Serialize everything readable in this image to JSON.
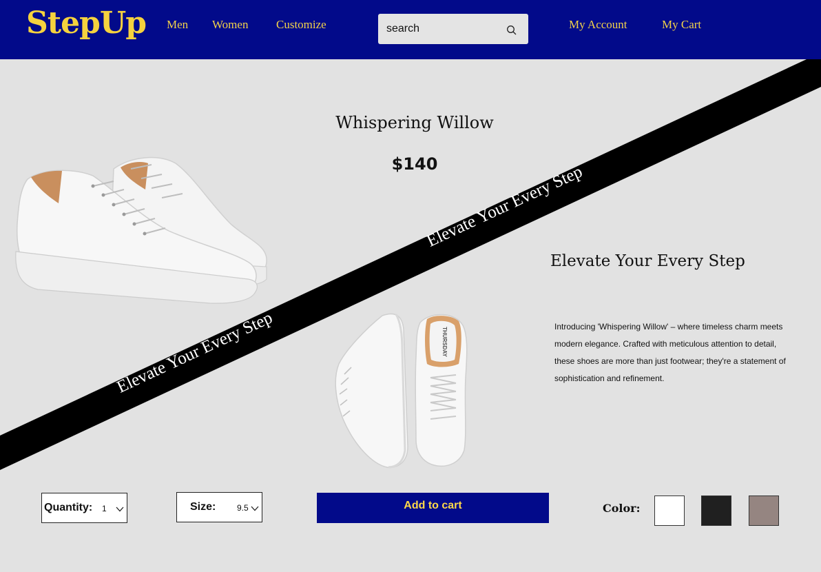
{
  "header": {
    "logo": "StepUp",
    "nav": [
      "Men",
      "Women",
      "Customize"
    ],
    "search": {
      "placeholder": "search"
    },
    "account": "My Account",
    "cart": "My Cart"
  },
  "banner": {
    "text_upper": "Elevate Your Every Step",
    "text_lower": "Elevate Your Every Step"
  },
  "product": {
    "name": "Whispering Willow",
    "price": "$140",
    "tagline": "Elevate Your Every Step",
    "description": "Introducing 'Whispering Willow' – where timeless charm meets modern elegance. Crafted with meticulous attention to detail, these shoes are more than just footwear; they're a statement of sophistication and refinement.",
    "brand_on_insole": "THURSDAY"
  },
  "controls": {
    "quantity_label": "Quantity:",
    "quantity_value": "1",
    "size_label": "Size:",
    "size_value": "9.5",
    "add_to_cart": "Add to cart",
    "color_label": "Color:",
    "colors": [
      "#ffffff",
      "#202020",
      "#958581"
    ]
  },
  "icons": {
    "search": "search-icon",
    "chevron": "chevron-down-icon"
  }
}
